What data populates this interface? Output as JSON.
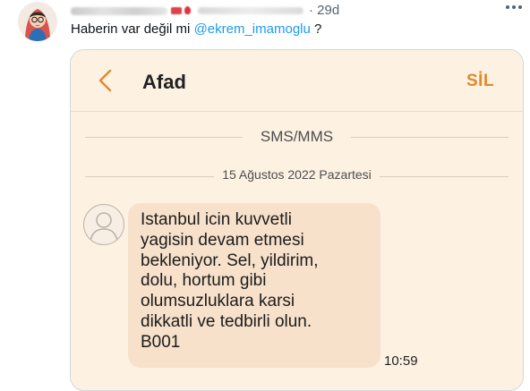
{
  "tweet": {
    "time": "· 29d",
    "text_prefix": "Haberin var değil mi ",
    "mention": "@ekrem_imamoglu",
    "text_suffix": " ?"
  },
  "sms": {
    "contact": "Afad",
    "delete_label": "SİL",
    "category": "SMS/MMS",
    "date": "15 Ağustos 2022 Pazartesi",
    "message": "Istanbul icin kuvvetli\nyagisin devam etmesi\nbekleniyor. Sel, yildirim,\ndolu, hortum gibi\nolumsuzluklara karsi\ndikkatli ve tedbirli olun.\nB001",
    "time": "10:59"
  },
  "colors": {
    "accent": "#e08a2c",
    "mention": "#1d9bf0",
    "bubble": "#f7e1cb",
    "background": "#fdf1e2"
  },
  "icons": [
    "avatar",
    "flag-icon",
    "rose-icon",
    "more-icon",
    "back-icon",
    "contact-avatar-icon"
  ]
}
